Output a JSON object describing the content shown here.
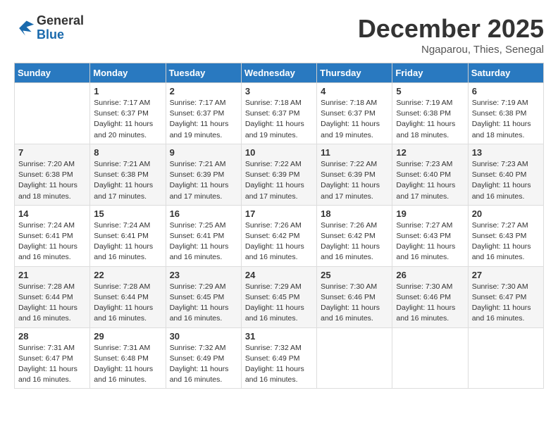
{
  "logo": {
    "general": "General",
    "blue": "Blue"
  },
  "title": "December 2025",
  "subtitle": "Ngaparou, Thies, Senegal",
  "days_header": [
    "Sunday",
    "Monday",
    "Tuesday",
    "Wednesday",
    "Thursday",
    "Friday",
    "Saturday"
  ],
  "weeks": [
    [
      {
        "num": "",
        "sunrise": "",
        "sunset": "",
        "daylight": ""
      },
      {
        "num": "1",
        "sunrise": "Sunrise: 7:17 AM",
        "sunset": "Sunset: 6:37 PM",
        "daylight": "Daylight: 11 hours and 20 minutes."
      },
      {
        "num": "2",
        "sunrise": "Sunrise: 7:17 AM",
        "sunset": "Sunset: 6:37 PM",
        "daylight": "Daylight: 11 hours and 19 minutes."
      },
      {
        "num": "3",
        "sunrise": "Sunrise: 7:18 AM",
        "sunset": "Sunset: 6:37 PM",
        "daylight": "Daylight: 11 hours and 19 minutes."
      },
      {
        "num": "4",
        "sunrise": "Sunrise: 7:18 AM",
        "sunset": "Sunset: 6:37 PM",
        "daylight": "Daylight: 11 hours and 19 minutes."
      },
      {
        "num": "5",
        "sunrise": "Sunrise: 7:19 AM",
        "sunset": "Sunset: 6:38 PM",
        "daylight": "Daylight: 11 hours and 18 minutes."
      },
      {
        "num": "6",
        "sunrise": "Sunrise: 7:19 AM",
        "sunset": "Sunset: 6:38 PM",
        "daylight": "Daylight: 11 hours and 18 minutes."
      }
    ],
    [
      {
        "num": "7",
        "sunrise": "Sunrise: 7:20 AM",
        "sunset": "Sunset: 6:38 PM",
        "daylight": "Daylight: 11 hours and 18 minutes."
      },
      {
        "num": "8",
        "sunrise": "Sunrise: 7:21 AM",
        "sunset": "Sunset: 6:38 PM",
        "daylight": "Daylight: 11 hours and 17 minutes."
      },
      {
        "num": "9",
        "sunrise": "Sunrise: 7:21 AM",
        "sunset": "Sunset: 6:39 PM",
        "daylight": "Daylight: 11 hours and 17 minutes."
      },
      {
        "num": "10",
        "sunrise": "Sunrise: 7:22 AM",
        "sunset": "Sunset: 6:39 PM",
        "daylight": "Daylight: 11 hours and 17 minutes."
      },
      {
        "num": "11",
        "sunrise": "Sunrise: 7:22 AM",
        "sunset": "Sunset: 6:39 PM",
        "daylight": "Daylight: 11 hours and 17 minutes."
      },
      {
        "num": "12",
        "sunrise": "Sunrise: 7:23 AM",
        "sunset": "Sunset: 6:40 PM",
        "daylight": "Daylight: 11 hours and 17 minutes."
      },
      {
        "num": "13",
        "sunrise": "Sunrise: 7:23 AM",
        "sunset": "Sunset: 6:40 PM",
        "daylight": "Daylight: 11 hours and 16 minutes."
      }
    ],
    [
      {
        "num": "14",
        "sunrise": "Sunrise: 7:24 AM",
        "sunset": "Sunset: 6:41 PM",
        "daylight": "Daylight: 11 hours and 16 minutes."
      },
      {
        "num": "15",
        "sunrise": "Sunrise: 7:24 AM",
        "sunset": "Sunset: 6:41 PM",
        "daylight": "Daylight: 11 hours and 16 minutes."
      },
      {
        "num": "16",
        "sunrise": "Sunrise: 7:25 AM",
        "sunset": "Sunset: 6:41 PM",
        "daylight": "Daylight: 11 hours and 16 minutes."
      },
      {
        "num": "17",
        "sunrise": "Sunrise: 7:26 AM",
        "sunset": "Sunset: 6:42 PM",
        "daylight": "Daylight: 11 hours and 16 minutes."
      },
      {
        "num": "18",
        "sunrise": "Sunrise: 7:26 AM",
        "sunset": "Sunset: 6:42 PM",
        "daylight": "Daylight: 11 hours and 16 minutes."
      },
      {
        "num": "19",
        "sunrise": "Sunrise: 7:27 AM",
        "sunset": "Sunset: 6:43 PM",
        "daylight": "Daylight: 11 hours and 16 minutes."
      },
      {
        "num": "20",
        "sunrise": "Sunrise: 7:27 AM",
        "sunset": "Sunset: 6:43 PM",
        "daylight": "Daylight: 11 hours and 16 minutes."
      }
    ],
    [
      {
        "num": "21",
        "sunrise": "Sunrise: 7:28 AM",
        "sunset": "Sunset: 6:44 PM",
        "daylight": "Daylight: 11 hours and 16 minutes."
      },
      {
        "num": "22",
        "sunrise": "Sunrise: 7:28 AM",
        "sunset": "Sunset: 6:44 PM",
        "daylight": "Daylight: 11 hours and 16 minutes."
      },
      {
        "num": "23",
        "sunrise": "Sunrise: 7:29 AM",
        "sunset": "Sunset: 6:45 PM",
        "daylight": "Daylight: 11 hours and 16 minutes."
      },
      {
        "num": "24",
        "sunrise": "Sunrise: 7:29 AM",
        "sunset": "Sunset: 6:45 PM",
        "daylight": "Daylight: 11 hours and 16 minutes."
      },
      {
        "num": "25",
        "sunrise": "Sunrise: 7:30 AM",
        "sunset": "Sunset: 6:46 PM",
        "daylight": "Daylight: 11 hours and 16 minutes."
      },
      {
        "num": "26",
        "sunrise": "Sunrise: 7:30 AM",
        "sunset": "Sunset: 6:46 PM",
        "daylight": "Daylight: 11 hours and 16 minutes."
      },
      {
        "num": "27",
        "sunrise": "Sunrise: 7:30 AM",
        "sunset": "Sunset: 6:47 PM",
        "daylight": "Daylight: 11 hours and 16 minutes."
      }
    ],
    [
      {
        "num": "28",
        "sunrise": "Sunrise: 7:31 AM",
        "sunset": "Sunset: 6:47 PM",
        "daylight": "Daylight: 11 hours and 16 minutes."
      },
      {
        "num": "29",
        "sunrise": "Sunrise: 7:31 AM",
        "sunset": "Sunset: 6:48 PM",
        "daylight": "Daylight: 11 hours and 16 minutes."
      },
      {
        "num": "30",
        "sunrise": "Sunrise: 7:32 AM",
        "sunset": "Sunset: 6:49 PM",
        "daylight": "Daylight: 11 hours and 16 minutes."
      },
      {
        "num": "31",
        "sunrise": "Sunrise: 7:32 AM",
        "sunset": "Sunset: 6:49 PM",
        "daylight": "Daylight: 11 hours and 16 minutes."
      },
      {
        "num": "",
        "sunrise": "",
        "sunset": "",
        "daylight": ""
      },
      {
        "num": "",
        "sunrise": "",
        "sunset": "",
        "daylight": ""
      },
      {
        "num": "",
        "sunrise": "",
        "sunset": "",
        "daylight": ""
      }
    ]
  ]
}
